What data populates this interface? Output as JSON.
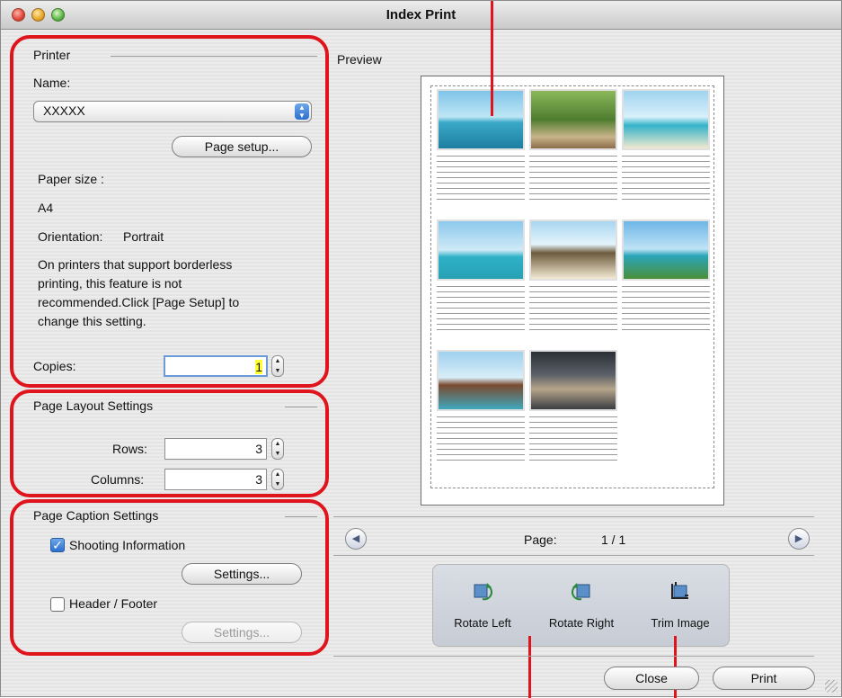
{
  "window": {
    "title": "Index Print"
  },
  "printer": {
    "section_label": "Printer",
    "name_label": "Name:",
    "name_value": "XXXXX",
    "page_setup_button": "Page setup...",
    "paper_size_label": "Paper size :",
    "paper_size_value": "A4",
    "orientation_label": "Orientation:",
    "orientation_value": "Portrait",
    "note_line1": "On printers that support borderless",
    "note_line2": "printing, this feature is not",
    "note_line3": "recommended.Click [Page Setup] to",
    "note_line4": "change this setting.",
    "copies_label": "Copies:",
    "copies_value": "1"
  },
  "layout": {
    "section_label": "Page Layout Settings",
    "rows_label": "Rows:",
    "rows_value": "3",
    "columns_label": "Columns:",
    "columns_value": "3"
  },
  "caption": {
    "section_label": "Page Caption Settings",
    "shooting_info_label": "Shooting Information",
    "shooting_info_checked": true,
    "shooting_settings_button": "Settings...",
    "header_footer_label": "Header / Footer",
    "header_footer_checked": false,
    "header_footer_settings_button": "Settings..."
  },
  "preview": {
    "label": "Preview",
    "thumbnail_count": 8,
    "page_label": "Page:",
    "page_value": "1 / 1"
  },
  "tools": {
    "rotate_left": "Rotate Left",
    "rotate_right": "Rotate Right",
    "trim_image": "Trim Image"
  },
  "footer": {
    "close_button": "Close",
    "print_button": "Print"
  },
  "colors": {
    "callout_red": "#e0141c",
    "accent_blue": "#2b6fd0"
  }
}
